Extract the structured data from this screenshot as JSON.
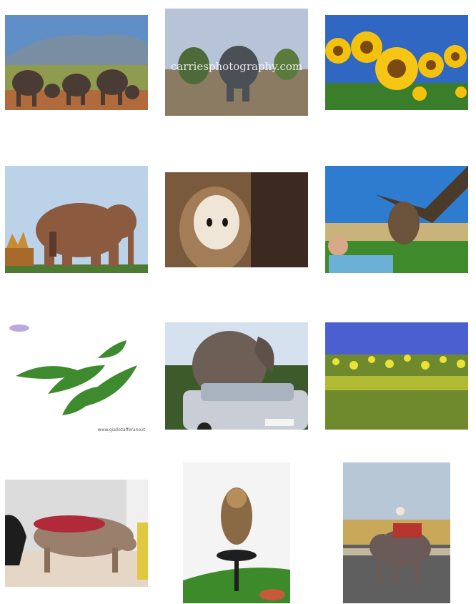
{
  "images": [
    {
      "subject": "elephant-herd"
    },
    {
      "subject": "elephant-savanna",
      "watermark": "carriesphotography.com"
    },
    {
      "subject": "sunflowers"
    },
    {
      "subject": "elephant-temple"
    },
    {
      "subject": "barn-owl"
    },
    {
      "subject": "eagle-owl-with-man"
    },
    {
      "subject": "arugula-leaves",
      "credit": "www.giallozafferano.it"
    },
    {
      "subject": "elephant-and-car"
    },
    {
      "subject": "rapeseed-field"
    },
    {
      "subject": "injured-dog"
    },
    {
      "subject": "owl-on-perch"
    },
    {
      "subject": "elephant-ride"
    }
  ]
}
